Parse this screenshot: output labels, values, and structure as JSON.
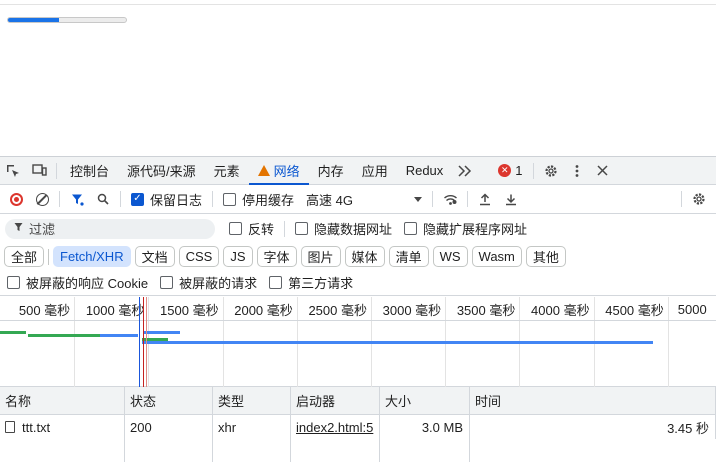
{
  "page": {
    "progress_fraction": 0.43
  },
  "devtools": {
    "tabs": [
      {
        "label": "控制台"
      },
      {
        "label": "源代码/来源"
      },
      {
        "label": "元素"
      },
      {
        "label": "网络",
        "active": true,
        "warning": true
      },
      {
        "label": "内存"
      },
      {
        "label": "应用"
      },
      {
        "label": "Redux"
      }
    ],
    "error_count": "1",
    "toolbar": {
      "preserve_log": {
        "label": "保留日志",
        "checked": true
      },
      "disable_cache": {
        "label": "停用缓存",
        "checked": false
      },
      "throttle": "高速 4G"
    },
    "filter": {
      "placeholder": "过滤",
      "invert": "反转",
      "hide_data_urls": "隐藏数据网址",
      "hide_extension_urls": "隐藏扩展程序网址"
    },
    "types": [
      "全部",
      "Fetch/XHR",
      "文档",
      "CSS",
      "JS",
      "字体",
      "图片",
      "媒体",
      "清单",
      "WS",
      "Wasm",
      "其他"
    ],
    "active_type": "Fetch/XHR",
    "blocked": {
      "blocked_response_cookies": "被屏蔽的响应 Cookie",
      "blocked_requests": "被屏蔽的请求",
      "third_party": "第三方请求"
    },
    "overview_ticks": [
      "500 毫秒",
      "1000 毫秒",
      "1500 毫秒",
      "2000 毫秒",
      "2500 毫秒",
      "3000 毫秒",
      "3500 毫秒",
      "4000 毫秒",
      "4500 毫秒",
      "5000"
    ],
    "colors": {
      "accent": "#0b57d0",
      "error": "#dc362e",
      "warning": "#e37400",
      "bar_green": "#34a853",
      "bar_blue": "#4285f4"
    },
    "columns": [
      "名称",
      "状态",
      "类型",
      "启动器",
      "大小",
      "时间"
    ],
    "rows": [
      {
        "name": "ttt.txt",
        "status": "200",
        "type": "xhr",
        "initiator": "index2.html:5",
        "size": "3.0 MB",
        "time": "3.45 秒"
      }
    ]
  }
}
